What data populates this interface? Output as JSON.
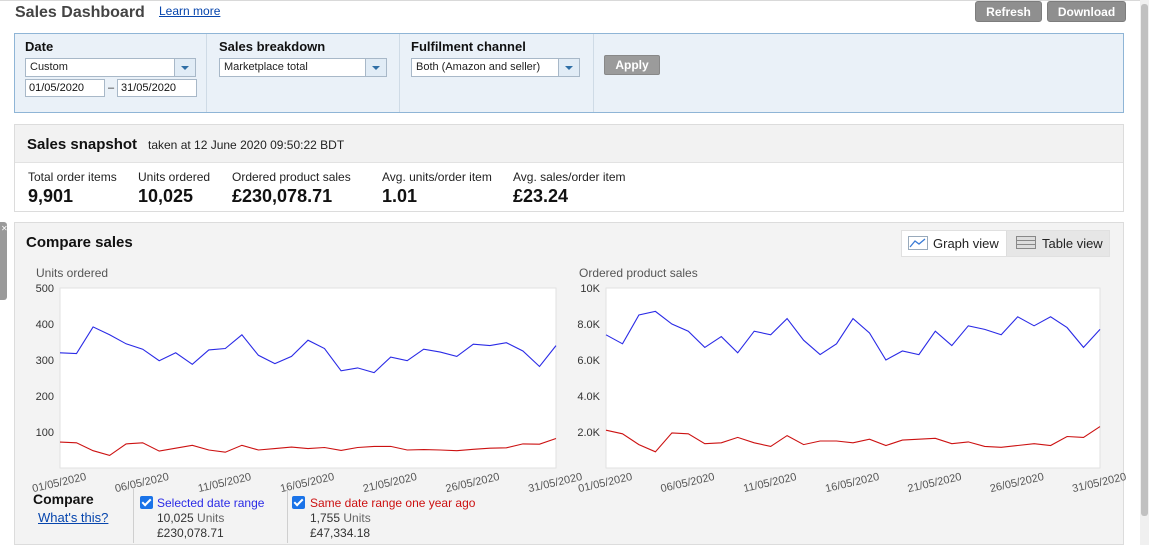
{
  "header": {
    "title": "Sales Dashboard",
    "learn_more": "Learn more",
    "refresh_label": "Refresh",
    "download_label": "Download"
  },
  "filters": {
    "date": {
      "label": "Date",
      "value": "Custom",
      "from": "01/05/2020",
      "to": "31/05/2020",
      "dash": "–"
    },
    "sales_breakdown": {
      "label": "Sales breakdown",
      "value": "Marketplace total"
    },
    "fulfilment": {
      "label": "Fulfilment channel",
      "value": "Both (Amazon and seller)"
    },
    "apply_label": "Apply"
  },
  "snapshot": {
    "title": "Sales snapshot",
    "taken": "taken at 12 June 2020 09:50:22 BDT",
    "metrics": [
      {
        "label": "Total order items",
        "value": "9,901"
      },
      {
        "label": "Units ordered",
        "value": "10,025"
      },
      {
        "label": "Ordered product sales",
        "value": "£230,078.71"
      },
      {
        "label": "Avg. units/order item",
        "value": "1.01"
      },
      {
        "label": "Avg. sales/order item",
        "value": "£23.24"
      }
    ]
  },
  "compare": {
    "title": "Compare sales",
    "graph_view": "Graph view",
    "table_view": "Table view",
    "compare_label": "Compare",
    "whats_this": "What's this?",
    "selected": {
      "label": "Selected date range",
      "units": "10,025",
      "unit_word": "Units",
      "sales": "£230,078.71",
      "color": "#2a2ae6"
    },
    "last_year": {
      "label": "Same date range one year ago",
      "units": "1,755",
      "unit_word": "Units",
      "sales": "£47,334.18",
      "color": "#cc1111"
    }
  },
  "chart_data": [
    {
      "type": "line",
      "title": "Units ordered",
      "ylim": [
        0,
        500
      ],
      "yticks": [
        100,
        200,
        300,
        400,
        500
      ],
      "ytick_labels": [
        "100",
        "200",
        "300",
        "400",
        "500"
      ],
      "x": [
        "01/05/2020",
        "02/05/2020",
        "03/05/2020",
        "04/05/2020",
        "05/05/2020",
        "06/05/2020",
        "07/05/2020",
        "08/05/2020",
        "09/05/2020",
        "10/05/2020",
        "11/05/2020",
        "12/05/2020",
        "13/05/2020",
        "14/05/2020",
        "15/05/2020",
        "16/05/2020",
        "17/05/2020",
        "18/05/2020",
        "19/05/2020",
        "20/05/2020",
        "21/05/2020",
        "22/05/2020",
        "23/05/2020",
        "24/05/2020",
        "25/05/2020",
        "26/05/2020",
        "27/05/2020",
        "28/05/2020",
        "29/05/2020",
        "30/05/2020",
        "31/05/2020"
      ],
      "xtick_labels": [
        "01/05/2020",
        "06/05/2020",
        "11/05/2020",
        "16/05/2020",
        "21/05/2020",
        "26/05/2020",
        "31/05/2020"
      ],
      "grid": false,
      "series": [
        {
          "name": "Selected date range",
          "color": "#2a2ae6",
          "values": [
            320,
            318,
            392,
            370,
            345,
            330,
            298,
            320,
            288,
            328,
            332,
            370,
            313,
            290,
            310,
            355,
            332,
            270,
            278,
            265,
            308,
            298,
            330,
            322,
            310,
            344,
            340,
            348,
            325,
            282,
            340
          ]
        },
        {
          "name": "Same date range one year ago",
          "color": "#cc1111",
          "values": [
            72,
            70,
            48,
            35,
            67,
            70,
            47,
            55,
            63,
            50,
            44,
            63,
            50,
            54,
            58,
            54,
            57,
            49,
            57,
            60,
            60,
            50,
            51,
            50,
            48,
            52,
            55,
            56,
            67,
            66,
            82
          ]
        }
      ]
    },
    {
      "type": "line",
      "title": "Ordered product sales",
      "ylim": [
        0,
        10000
      ],
      "yticks": [
        2000,
        4000,
        6000,
        8000,
        10000
      ],
      "ytick_labels": [
        "2.0K",
        "4.0K",
        "6.0K",
        "8.0K",
        "10K"
      ],
      "x": [
        "01/05/2020",
        "02/05/2020",
        "03/05/2020",
        "04/05/2020",
        "05/05/2020",
        "06/05/2020",
        "07/05/2020",
        "08/05/2020",
        "09/05/2020",
        "10/05/2020",
        "11/05/2020",
        "12/05/2020",
        "13/05/2020",
        "14/05/2020",
        "15/05/2020",
        "16/05/2020",
        "17/05/2020",
        "18/05/2020",
        "19/05/2020",
        "20/05/2020",
        "21/05/2020",
        "22/05/2020",
        "23/05/2020",
        "24/05/2020",
        "25/05/2020",
        "26/05/2020",
        "27/05/2020",
        "28/05/2020",
        "29/05/2020",
        "30/05/2020",
        "31/05/2020"
      ],
      "xtick_labels": [
        "01/05/2020",
        "06/05/2020",
        "11/05/2020",
        "16/05/2020",
        "21/05/2020",
        "26/05/2020",
        "31/05/2020"
      ],
      "grid": false,
      "series": [
        {
          "name": "Selected date range",
          "color": "#2a2ae6",
          "values": [
            7400,
            6900,
            8500,
            8700,
            8000,
            7600,
            6700,
            7300,
            6400,
            7600,
            7400,
            8300,
            7100,
            6300,
            6900,
            8300,
            7500,
            6000,
            6500,
            6300,
            7600,
            6800,
            7900,
            7700,
            7400,
            8400,
            7900,
            8400,
            7800,
            6700,
            7700
          ]
        },
        {
          "name": "Same date range one year ago",
          "color": "#cc1111",
          "values": [
            2100,
            1900,
            1300,
            900,
            1950,
            1900,
            1350,
            1400,
            1700,
            1400,
            1200,
            1800,
            1300,
            1500,
            1500,
            1400,
            1600,
            1250,
            1550,
            1600,
            1650,
            1350,
            1450,
            1200,
            1150,
            1250,
            1350,
            1250,
            1750,
            1700,
            2300
          ]
        }
      ]
    }
  ]
}
